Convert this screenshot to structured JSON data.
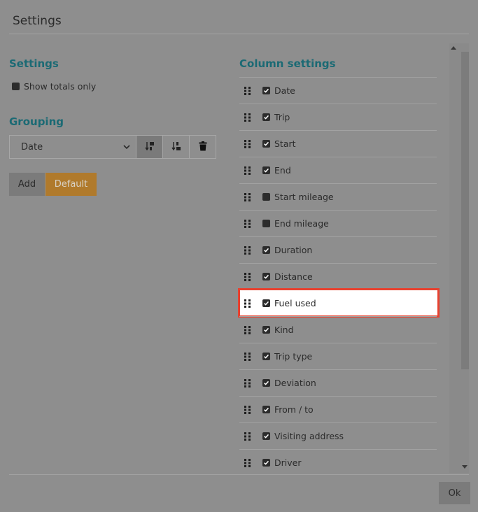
{
  "dialog": {
    "title": "Settings"
  },
  "settings": {
    "heading": "Settings",
    "show_totals_label": "Show totals only",
    "show_totals_checked": false
  },
  "grouping": {
    "heading": "Grouping",
    "selected": "Date",
    "add_label": "Add",
    "default_label": "Default"
  },
  "columns": {
    "heading": "Column settings",
    "items": [
      {
        "label": "Date",
        "checked": true
      },
      {
        "label": "Trip",
        "checked": true
      },
      {
        "label": "Start",
        "checked": true
      },
      {
        "label": "End",
        "checked": true
      },
      {
        "label": "Start mileage",
        "checked": false
      },
      {
        "label": "End mileage",
        "checked": false
      },
      {
        "label": "Duration",
        "checked": true
      },
      {
        "label": "Distance",
        "checked": true
      },
      {
        "label": "Fuel used",
        "checked": true,
        "highlighted": true
      },
      {
        "label": "Kind",
        "checked": true
      },
      {
        "label": "Trip type",
        "checked": true
      },
      {
        "label": "Deviation",
        "checked": true
      },
      {
        "label": "From / to",
        "checked": true
      },
      {
        "label": "Visiting address",
        "checked": true
      },
      {
        "label": "Driver",
        "checked": true
      }
    ]
  },
  "footer": {
    "ok_label": "Ok"
  },
  "colors": {
    "accent": "#1b6a74",
    "default_button": "#b07a2c",
    "highlight_border": "#e8412f"
  }
}
